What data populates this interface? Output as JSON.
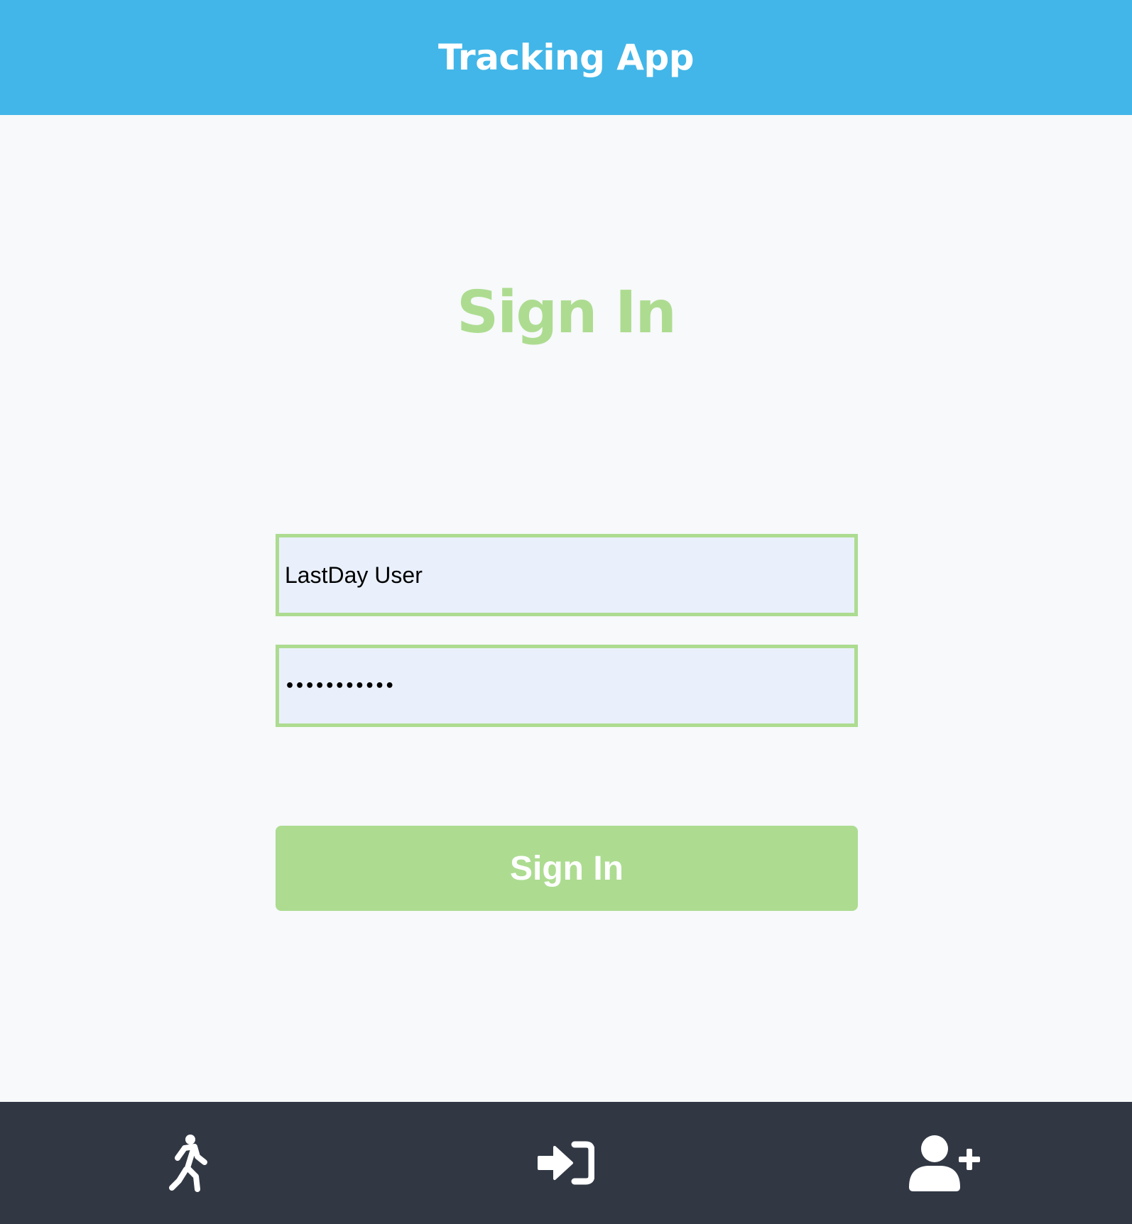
{
  "header": {
    "title": "Tracking App"
  },
  "main": {
    "title": "Sign In",
    "username_value": "LastDay User",
    "password_masked": "•••••••••••",
    "signin_label": "Sign In"
  },
  "bottom_nav": {
    "items": [
      {
        "icon": "running-person-icon",
        "target": "track"
      },
      {
        "icon": "sign-in-arrow-icon",
        "target": "signin"
      },
      {
        "icon": "add-user-icon",
        "target": "signup"
      }
    ]
  },
  "colors": {
    "header_bg": "#42b6e8",
    "accent_green": "#addc91",
    "input_bg": "#e9f0fc",
    "nav_bg": "#313844",
    "page_bg": "#f7f9fa"
  }
}
